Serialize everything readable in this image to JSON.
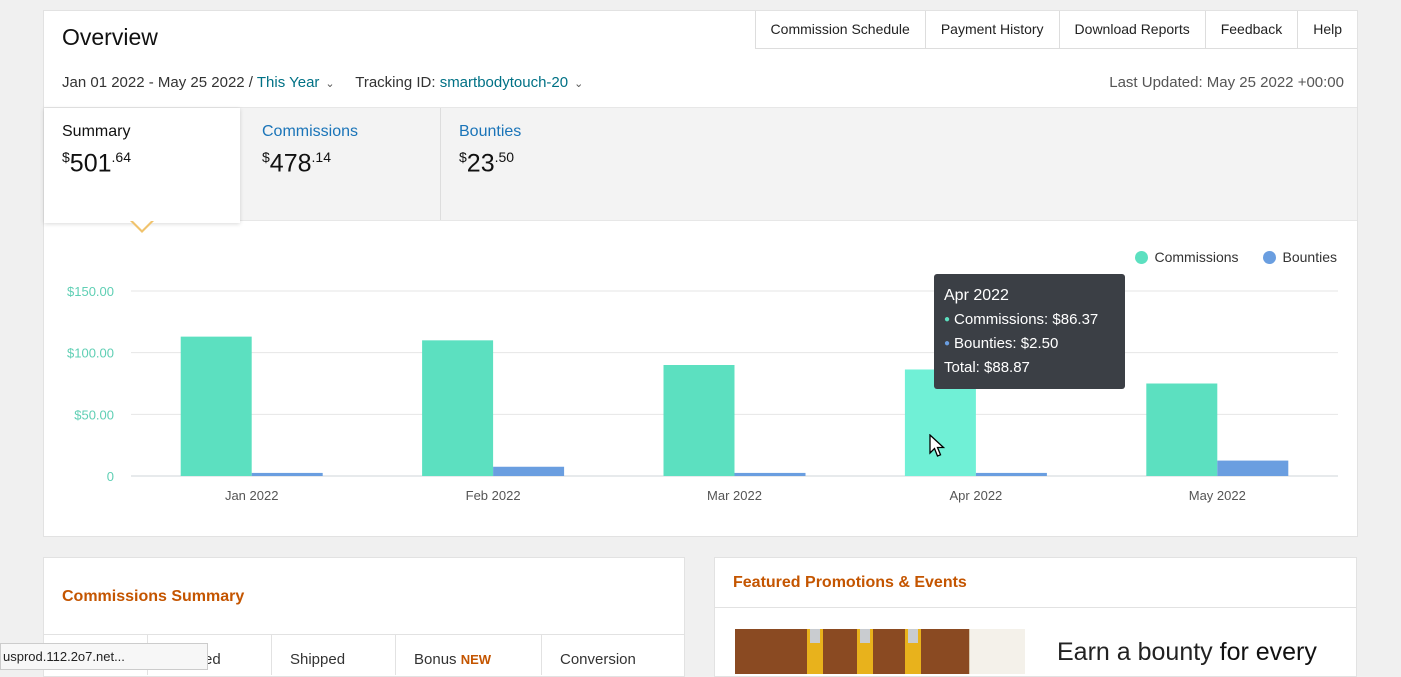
{
  "overview": {
    "title": "Overview",
    "links": [
      "Commission Schedule",
      "Payment History",
      "Download Reports",
      "Feedback",
      "Help"
    ],
    "date_range": "Jan 01 2022 - May 25 2022 /",
    "period": "This Year",
    "tracking_label": "Tracking ID:",
    "tracking_id": "smartbodytouch-20",
    "last_updated": "Last Updated: May 25 2022 +00:00"
  },
  "tabs": [
    {
      "label": "Summary",
      "currency": "$",
      "whole": "501",
      "cents": ".64"
    },
    {
      "label": "Commissions",
      "currency": "$",
      "whole": "478",
      "cents": ".14"
    },
    {
      "label": "Bounties",
      "currency": "$",
      "whole": "23",
      "cents": ".50"
    }
  ],
  "chart_data": {
    "type": "bar",
    "categories": [
      "Jan 2022",
      "Feb 2022",
      "Mar 2022",
      "Apr 2022",
      "May 2022"
    ],
    "series": [
      {
        "name": "Commissions",
        "color": "#5ce0c0",
        "values": [
          113,
          110,
          90,
          86.37,
          75
        ]
      },
      {
        "name": "Bounties",
        "color": "#6a9ee0",
        "values": [
          2.5,
          7.5,
          2.5,
          2.5,
          12.5
        ]
      }
    ],
    "ylim": [
      0,
      150
    ],
    "yticks": [
      0,
      50,
      100,
      150
    ],
    "ytick_labels": [
      "0",
      "$50.00",
      "$100.00",
      "$150.00"
    ],
    "legend": "top-right",
    "grid": true,
    "highlight_index": 3,
    "highlight_color": "#70f0d6"
  },
  "tooltip": {
    "title": "Apr 2022",
    "commissions": "Commissions: $86.37",
    "bounties": "Bounties: $2.50",
    "total": "Total: $88.87"
  },
  "commissions_summary": {
    "title": "Commissions Summary",
    "columns": [
      "ed",
      "Shipped",
      "Bonus",
      "Conversion"
    ],
    "new_badge": "NEW"
  },
  "featured": {
    "title": "Featured Promotions & Events",
    "text_bold": "Earn a bounty",
    "text_rest": " for every"
  },
  "status_bar": "usprod.112.2o7.net..."
}
